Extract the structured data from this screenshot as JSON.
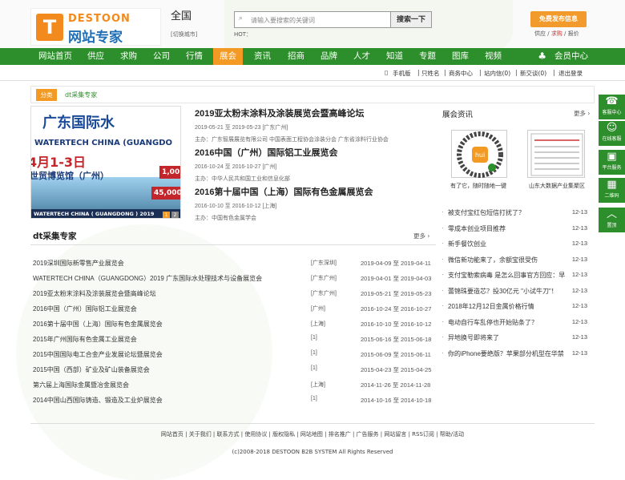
{
  "header": {
    "logo_letter": "T",
    "logo_brand": "DESTOON",
    "logo_cn": "网站专家",
    "city": "全国",
    "city_switch": "[切换城市]",
    "search_placeholder": "请输入要搜索的关键词",
    "search_button": "搜索一下",
    "hot_label": "HOT：",
    "publish_button": "免费发布信息",
    "publish_links": [
      "供应",
      "求购",
      "报价"
    ]
  },
  "nav": {
    "items": [
      "网站首页",
      "供应",
      "求购",
      "公司",
      "行情",
      "展会",
      "资讯",
      "招商",
      "品牌",
      "人才",
      "知道",
      "专题",
      "图库",
      "视频"
    ],
    "active_index": 5,
    "member": "会员中心"
  },
  "subbar": [
    "手机版",
    "只姓名",
    "商务中心",
    "站内信(0)",
    "新交谈(0)",
    "退出登录"
  ],
  "breadcrumb": {
    "tag": "分类",
    "text": "dt采集专家"
  },
  "banner": {
    "line1": "广东国际水",
    "line2": "WATERTECH CHINA (GUANGDO",
    "line3": "4月1-3日",
    "line4": "世贸博览馆（广州）",
    "num1": "1,00",
    "num2": "45,000",
    "strip": "WATERTECH CHINA ( GUANGDONG ) 2019",
    "dots": [
      "1",
      "2"
    ]
  },
  "events": [
    {
      "title": "2019亚太粉末涂料及涂装展览会暨高峰论坛",
      "date": "2019-05-21 至 2019-05-23 [广东广州]",
      "host": "主办：广东智展展览有限公司 中国表面工程协会涂装分会 广东省涂料行业协会"
    },
    {
      "title": "2016中国（广州）国际铝工业展览会",
      "date": "2016-10-24 至 2016-10-27 [广州]",
      "host": "主办：中华人民共和国工业和信息化部"
    },
    {
      "title": "2016第十届中国（上海）国际有色金属展览会",
      "date": "2016-10-10 至 2016-10-12 [上海]",
      "host": "主办：中国有色金属学会"
    }
  ],
  "news": {
    "title": "展会资讯",
    "more": "更多",
    "captions": [
      "有了它，随时随地一键",
      "山东大数据产业集聚区"
    ],
    "items": [
      {
        "text": "被支付宝红包短信打扰了？",
        "date": "12-13"
      },
      {
        "text": "零成本创业项目推荐",
        "date": "12-13"
      },
      {
        "text": "新手餐饮创业",
        "date": "12-13"
      },
      {
        "text": "微信新功能来了，余额宝很受伤",
        "date": "12-13"
      },
      {
        "text": "支付宝勒索病毒 是怎么回事官方回应：早",
        "date": "12-13"
      },
      {
        "text": "蕾锦珠要造芯？投30亿元 \"小试牛刀\"！",
        "date": "12-13"
      },
      {
        "text": "2018年12月12日金属价格行情",
        "date": "12-13"
      },
      {
        "text": "电动自行车乱停也开始贴条了？",
        "date": "12-13"
      },
      {
        "text": "异地换号即将来了",
        "date": "12-13"
      },
      {
        "text": "你的iPhone要绝版？苹果部分机型在华禁",
        "date": "12-13"
      }
    ]
  },
  "list": {
    "title": "dt采集专家",
    "more": "更多",
    "rows": [
      {
        "name": "2019深圳国际新零售产业展览会",
        "area": "[广东深圳]",
        "date": "2019-04-09 至 2019-04-11"
      },
      {
        "name": "WATERTECH CHINA（GUANGDONG）2019 广东国际水处理技术与设备展览会",
        "area": "[广东广州]",
        "date": "2019-04-01 至 2019-04-03"
      },
      {
        "name": "2019亚太粉末涂料及涂装展览会暨高峰论坛",
        "area": "[广东广州]",
        "date": "2019-05-21 至 2019-05-23"
      },
      {
        "name": "2016中国（广州）国际铝工业展览会",
        "area": "[广州]",
        "date": "2016-10-24 至 2016-10-27"
      },
      {
        "name": "2016第十届中国（上海）国际有色金属展览会",
        "area": "[上海]",
        "date": "2016-10-10 至 2016-10-12"
      },
      {
        "name": "2015年广州国际有色金属工业展览会",
        "area": "[1]",
        "date": "2015-06-16 至 2015-06-18"
      },
      {
        "name": "2015中国国际电工合金产业发展论坛暨展览会",
        "area": "[1]",
        "date": "2015-06-09 至 2015-06-11"
      },
      {
        "name": "2015中国（西部）矿业及矿山装备展览会",
        "area": "[1]",
        "date": "2015-04-23 至 2015-04-25"
      },
      {
        "name": "第六届上海国际金属暨冶金展览会",
        "area": "[上海]",
        "date": "2014-11-26 至 2014-11-28"
      },
      {
        "name": "2014中国山西国际铸造、锻造及工业炉展览会",
        "area": "[1]",
        "date": "2014-10-16 至 2014-10-18"
      }
    ]
  },
  "footer": {
    "links": "网站首页 | 关于我们 | 联系方式 | 使用协议 | 版权隐私 | 网站地图 | 排名推广 | 广告服务 | 网站留言 | RSS订阅 | 帮助/活动",
    "copyright": "(c)2008-2018 DESTOON B2B SYSTEM All Rights Reserved"
  },
  "sidebar": [
    "客服中心",
    "在线客服",
    "平台服务",
    "二维码",
    "置顶"
  ]
}
